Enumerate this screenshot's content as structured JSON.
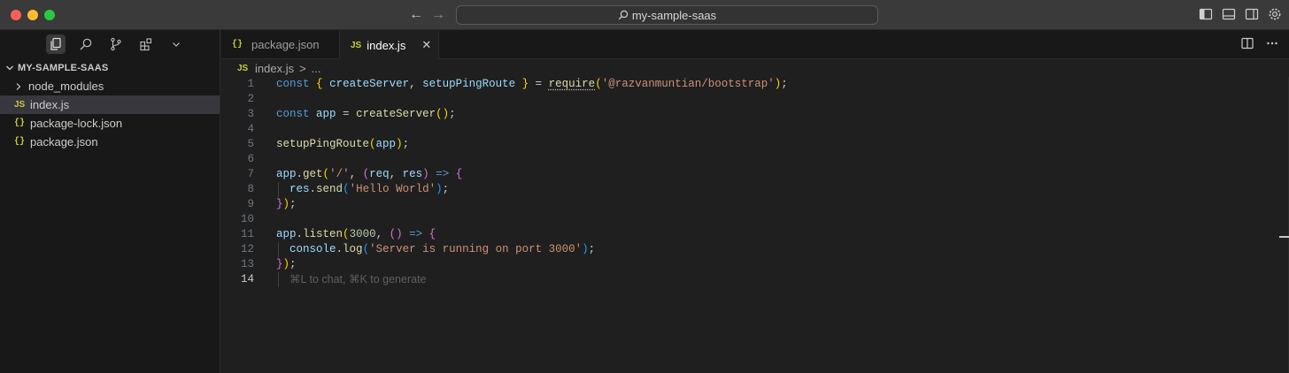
{
  "window": {
    "search_text": "my-sample-saas"
  },
  "sidebar": {
    "folder_title": "MY-SAMPLE-SAAS",
    "items": [
      {
        "label": "node_modules",
        "icon": "chevron-right-icon",
        "type": "folder"
      },
      {
        "label": "index.js",
        "icon": "JS",
        "type": "js",
        "selected": true
      },
      {
        "label": "package-lock.json",
        "icon": "{}",
        "type": "json"
      },
      {
        "label": "package.json",
        "icon": "{}",
        "type": "json"
      }
    ]
  },
  "tabs": [
    {
      "label": "package.json",
      "icon": "{}",
      "active": false
    },
    {
      "label": "index.js",
      "icon": "JS",
      "active": true,
      "close": "✕"
    }
  ],
  "breadcrumb": {
    "icon": "JS",
    "file": "index.js",
    "sep": ">",
    "more": "..."
  },
  "code": {
    "line_numbers": [
      "1",
      "2",
      "3",
      "4",
      "5",
      "6",
      "7",
      "8",
      "9",
      "10",
      "11",
      "12",
      "13",
      "14"
    ],
    "current_line": 14,
    "hint": "⌘L to chat, ⌘K to generate"
  },
  "colors": {
    "keyword": "#569cd6",
    "function": "#dcdcaa",
    "variable": "#9cdcfe",
    "string": "#ce9178",
    "number": "#b5cea8",
    "js_icon": "#cbcb41"
  }
}
